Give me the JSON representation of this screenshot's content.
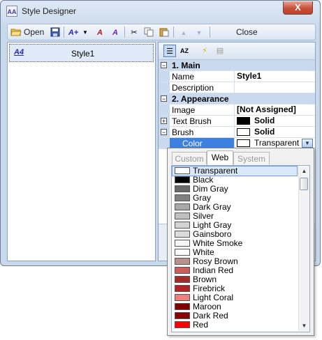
{
  "window": {
    "title": "Style Designer",
    "close_glyph": "X",
    "app_icon": "AA"
  },
  "toolbar": {
    "open_label": "Open",
    "close_label": "Close",
    "icons": [
      "open-folder-icon",
      "save-icon",
      "add-style-icon",
      "dropdown-arrow-icon",
      "rename-style-icon",
      "duplicate-style-icon",
      "cut-icon",
      "copy-icon",
      "paste-icon",
      "move-up-icon",
      "move-down-icon"
    ]
  },
  "style_list": {
    "items": [
      {
        "icon": "A4",
        "label": "Style1"
      }
    ]
  },
  "property_grid": {
    "categories": [
      {
        "label": "1. Main",
        "expander": "−",
        "rows": [
          {
            "name": "Name",
            "value": "Style1",
            "bold": true
          },
          {
            "name": "Description",
            "value": ""
          }
        ]
      },
      {
        "label": "2. Appearance",
        "expander": "−",
        "rows": [
          {
            "name": "Image",
            "value": "[Not Assigned]",
            "bold": true
          },
          {
            "name": "Text Brush",
            "value": "Solid",
            "swatch": "#000000",
            "expander": "+",
            "bold": true
          },
          {
            "name": "Brush",
            "value": "Solid",
            "swatch": "#ffffff",
            "expander": "−",
            "bold": true
          },
          {
            "name": "Color",
            "value": "Transparent",
            "swatch": "#ffffff",
            "selected": true
          }
        ]
      }
    ]
  },
  "color_popup": {
    "tabs": [
      "Custom",
      "Web",
      "System"
    ],
    "active_tab": "Web",
    "colors": [
      {
        "name": "Transparent",
        "hex": "#ffffff"
      },
      {
        "name": "Black",
        "hex": "#000000"
      },
      {
        "name": "Dim Gray",
        "hex": "#696969"
      },
      {
        "name": "Gray",
        "hex": "#808080"
      },
      {
        "name": "Dark Gray",
        "hex": "#a9a9a9"
      },
      {
        "name": "Silver",
        "hex": "#c0c0c0"
      },
      {
        "name": "Light Gray",
        "hex": "#d3d3d3"
      },
      {
        "name": "Gainsboro",
        "hex": "#dcdcdc"
      },
      {
        "name": "White Smoke",
        "hex": "#f5f5f5"
      },
      {
        "name": "White",
        "hex": "#ffffff"
      },
      {
        "name": "Rosy Brown",
        "hex": "#bc8f8f"
      },
      {
        "name": "Indian Red",
        "hex": "#cd5c5c"
      },
      {
        "name": "Brown",
        "hex": "#a52a2a"
      },
      {
        "name": "Firebrick",
        "hex": "#b22222"
      },
      {
        "name": "Light Coral",
        "hex": "#f08080"
      },
      {
        "name": "Maroon",
        "hex": "#800000"
      },
      {
        "name": "Dark Red",
        "hex": "#8b0000"
      },
      {
        "name": "Red",
        "hex": "#ff0000"
      }
    ],
    "selected_color": "Transparent"
  }
}
